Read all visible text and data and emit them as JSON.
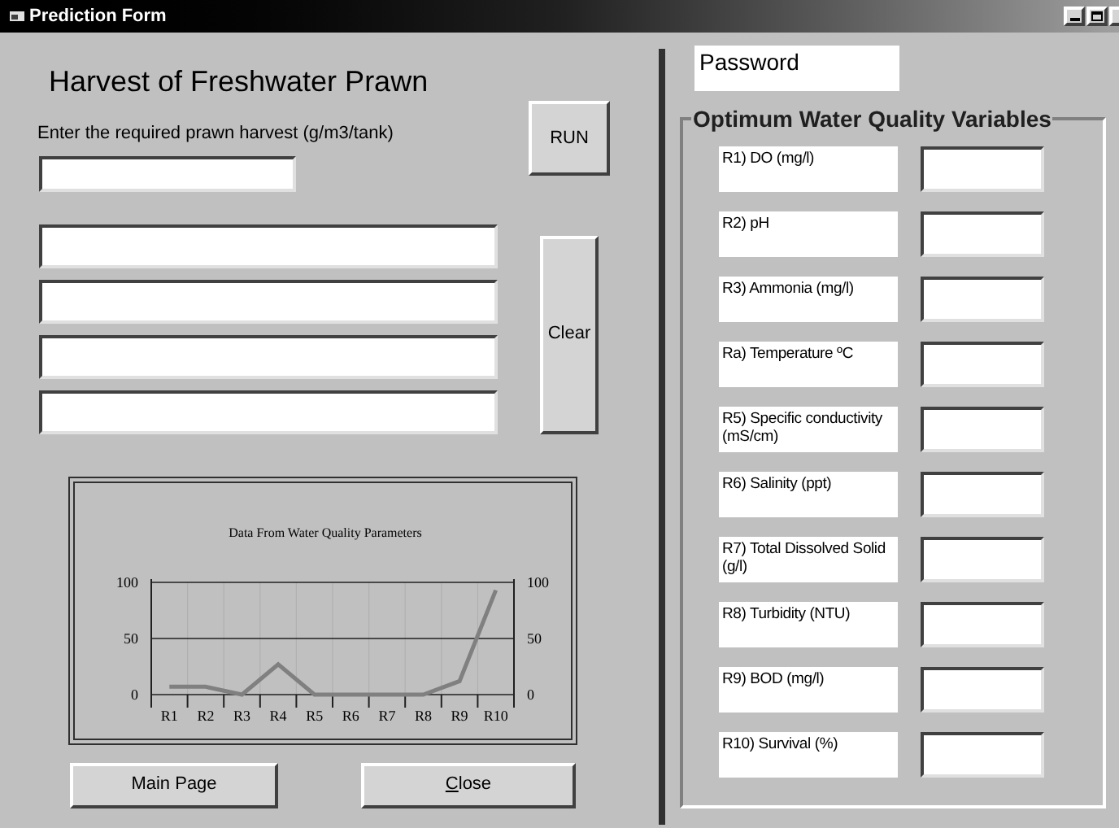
{
  "window": {
    "title": "Prediction Form"
  },
  "heading": "Harvest of Freshwater Prawn",
  "harvest_label": "Enter the required prawn harvest (g/m3/tank)",
  "buttons": [
    {
      "kind": "run",
      "label": "RUN"
    },
    {
      "kind": "clear",
      "label": "Clear"
    },
    {
      "kind": "main",
      "label": "Main Page"
    },
    {
      "kind": "close",
      "label": "Close",
      "mnemonic": true
    }
  ],
  "chart": {
    "chart_data": {
      "type": "line",
      "title": "Data From Water Quality Parameters",
      "categories": [
        "R1",
        "R2",
        "R3",
        "R4",
        "R5",
        "R6",
        "R7",
        "R8",
        "R9",
        "R10"
      ],
      "series": [
        {
          "color": "#808080",
          "values": [
            7,
            7,
            0,
            27,
            0,
            0,
            0,
            0,
            12,
            93
          ]
        }
      ],
      "ylim": [
        0,
        100
      ],
      "yticks": [
        0,
        50,
        100
      ],
      "ref_lines": [
        {
          "axis": "y",
          "value": 50
        }
      ]
    },
    "right_axis_labels": [
      "100",
      "50",
      "0"
    ]
  },
  "password_label": "Password",
  "group": {
    "title": "Optimum Water Quality Variables",
    "rows": [
      {
        "label": "R1) DO (mg/l)"
      },
      {
        "label": "R2) pH"
      },
      {
        "label": "R3) Ammonia (mg/l)"
      },
      {
        "label": "Ra) Temperature ºC"
      },
      {
        "label": "R5) Specific conductivity (mS/cm)"
      },
      {
        "label": "R6) Salinity (ppt)"
      },
      {
        "label": "R7) Total Dissolved Solid (g/l)"
      },
      {
        "label": "R8) Turbidity (NTU)"
      },
      {
        "label": "R9) BOD (mg/l)"
      },
      {
        "label": "R10) Survival (%)"
      }
    ]
  }
}
